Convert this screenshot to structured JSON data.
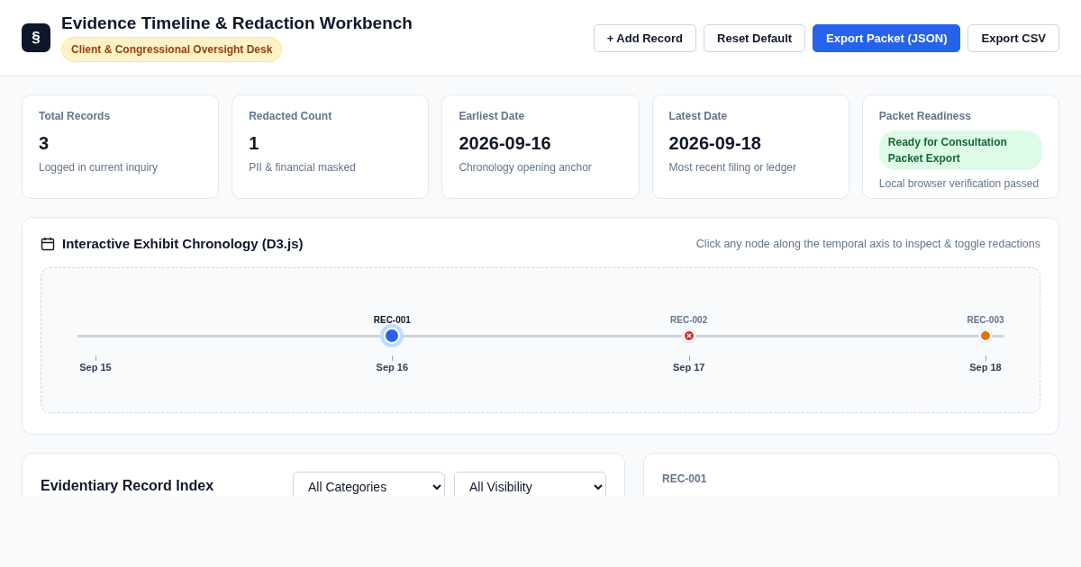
{
  "header": {
    "logo": "§",
    "title": "Evidence Timeline & Redaction Workbench",
    "badge": "Client & Congressional Oversight Desk",
    "buttons": [
      {
        "label": "+ Add Record",
        "kind": "outline"
      },
      {
        "label": "Reset Default",
        "kind": "outline"
      },
      {
        "label": "Export Packet (JSON)",
        "kind": "primary"
      },
      {
        "label": "Export CSV",
        "kind": "outline"
      }
    ]
  },
  "stats": [
    {
      "label": "Total Records",
      "value": "3",
      "note": "Logged in current inquiry",
      "kind": "value"
    },
    {
      "label": "Redacted Count",
      "value": "1",
      "note": "PII & financial masked",
      "kind": "value"
    },
    {
      "label": "Earliest Date",
      "value": "2026-09-16",
      "note": "Chronology opening anchor",
      "kind": "value"
    },
    {
      "label": "Latest Date",
      "value": "2026-09-18",
      "note": "Most recent filing or ledger",
      "kind": "value"
    },
    {
      "label": "Packet Readiness",
      "value": "Ready for Consultation Packet Export",
      "note": "Local browser verification passed",
      "kind": "status"
    }
  ],
  "chronology": {
    "title": "Interactive Exhibit Chronology (D3.js)",
    "hint": "Click any node along the temporal axis to inspect & toggle redactions",
    "ticks": [
      {
        "label": "Sep 15"
      },
      {
        "label": "Sep 16",
        "record": {
          "id": "REC-001",
          "selected": true,
          "redacted": false,
          "color": "#2563eb"
        }
      },
      {
        "label": "Sep 17",
        "record": {
          "id": "REC-002",
          "selected": false,
          "redacted": true,
          "color": "#dc2626"
        }
      },
      {
        "label": "Sep 18",
        "record": {
          "id": "REC-003",
          "selected": false,
          "redacted": false,
          "color": "#d97706"
        }
      }
    ]
  },
  "index": {
    "title": "Evidentiary Record Index",
    "filters": [
      {
        "value": "All Categories"
      },
      {
        "value": "All Visibility"
      }
    ]
  },
  "detail": {
    "id": "REC-001"
  }
}
